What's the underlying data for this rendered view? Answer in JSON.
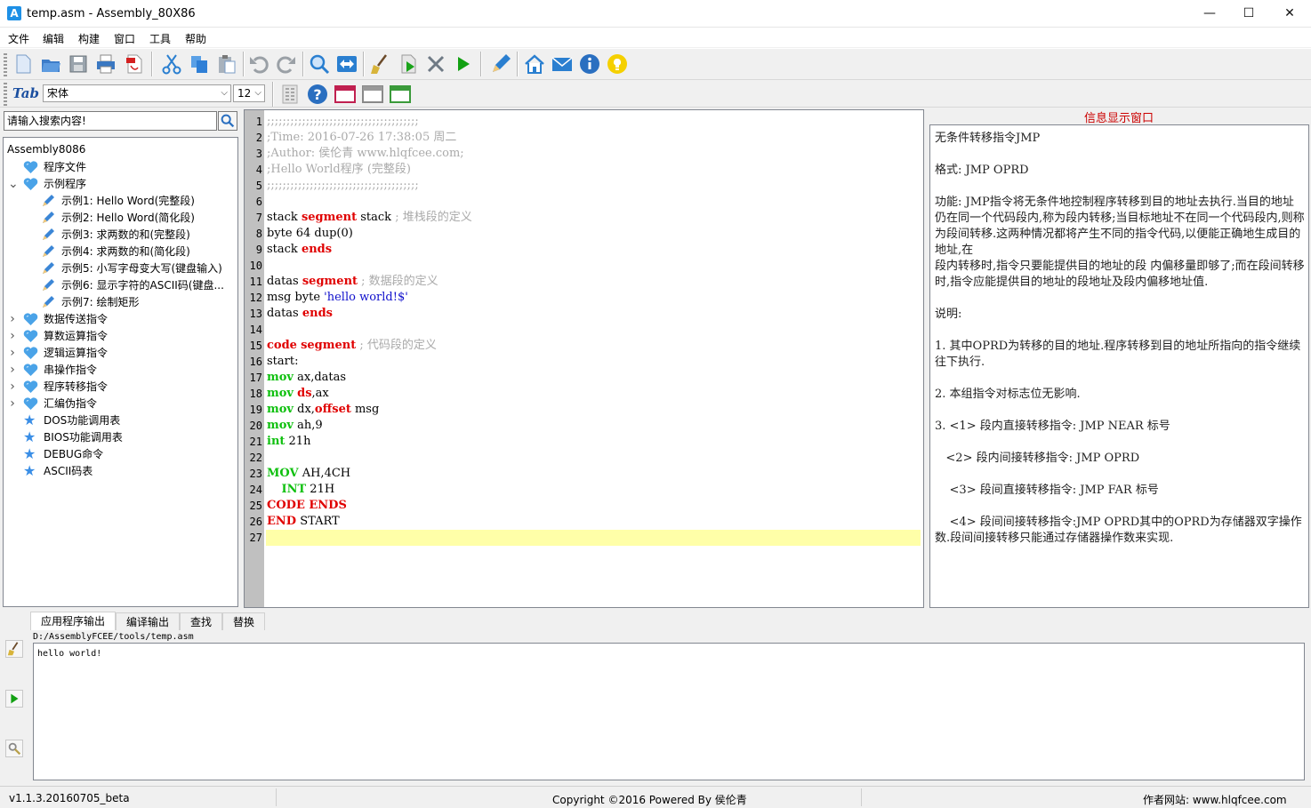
{
  "window": {
    "title": "temp.asm - Assembly_80X86",
    "app_icon_letter": "A",
    "minimize": "—",
    "maximize": "☐",
    "close": "✕"
  },
  "menu": [
    "文件",
    "编辑",
    "构建",
    "窗口",
    "工具",
    "帮助"
  ],
  "toolbar2": {
    "tab_label": "Tab",
    "font_name": "宋体",
    "font_size": "12"
  },
  "search": {
    "value": "请输入搜索内容!"
  },
  "tree": {
    "root": "Assembly8086",
    "items": [
      {
        "label": "程序文件",
        "icon": "heart-icon",
        "level": 1,
        "twisty": ""
      },
      {
        "label": "示例程序",
        "icon": "heart-icon",
        "level": 1,
        "twisty": "v"
      },
      {
        "label": "示例1:  Hello Word(完整段)",
        "icon": "pencil-icon",
        "level": 2,
        "twisty": ""
      },
      {
        "label": "示例2:  Hello Word(简化段)",
        "icon": "pencil-icon",
        "level": 2,
        "twisty": ""
      },
      {
        "label": "示例3:  求两数的和(完整段)",
        "icon": "pencil-icon",
        "level": 2,
        "twisty": ""
      },
      {
        "label": "示例4:  求两数的和(简化段)",
        "icon": "pencil-icon",
        "level": 2,
        "twisty": ""
      },
      {
        "label": "示例5:  小写字母变大写(键盘输入)",
        "icon": "pencil-icon",
        "level": 2,
        "twisty": ""
      },
      {
        "label": "示例6:  显示字符的ASCII码(键盘...",
        "icon": "pencil-icon",
        "level": 2,
        "twisty": ""
      },
      {
        "label": "示例7:  绘制矩形",
        "icon": "pencil-icon",
        "level": 2,
        "twisty": ""
      },
      {
        "label": "数据传送指令",
        "icon": "heart-icon",
        "level": 1,
        "twisty": ">"
      },
      {
        "label": "算数运算指令",
        "icon": "heart-icon",
        "level": 1,
        "twisty": ">"
      },
      {
        "label": "逻辑运算指令",
        "icon": "heart-icon",
        "level": 1,
        "twisty": ">"
      },
      {
        "label": "串操作指令",
        "icon": "heart-icon",
        "level": 1,
        "twisty": ">"
      },
      {
        "label": "程序转移指令",
        "icon": "heart-icon",
        "level": 1,
        "twisty": ">"
      },
      {
        "label": "汇编伪指令",
        "icon": "heart-icon",
        "level": 1,
        "twisty": ">"
      },
      {
        "label": "DOS功能调用表",
        "icon": "star-icon",
        "level": 1,
        "twisty": ""
      },
      {
        "label": "BIOS功能调用表",
        "icon": "star-icon",
        "level": 1,
        "twisty": ""
      },
      {
        "label": "DEBUG命令",
        "icon": "star-icon",
        "level": 1,
        "twisty": ""
      },
      {
        "label": "ASCII码表",
        "icon": "star-icon",
        "level": 1,
        "twisty": ""
      }
    ]
  },
  "editor": {
    "current_line": 27,
    "lines": [
      [
        [
          "cmt",
          ";;;;;;;;;;;;;;;;;;;;;;;;;;;;;;;;;;;;;;;"
        ]
      ],
      [
        [
          "cmt",
          ";Time: 2016-07-26 17:38:05 周二"
        ]
      ],
      [
        [
          "cmt",
          ";Author: 侯伦青 www.hlqfcee.com;"
        ]
      ],
      [
        [
          "cmt",
          ";Hello World程序 (完整段)"
        ]
      ],
      [
        [
          "cmt",
          ";;;;;;;;;;;;;;;;;;;;;;;;;;;;;;;;;;;;;;;"
        ]
      ],
      [],
      [
        [
          "",
          "stack "
        ],
        [
          "kw",
          "segment"
        ],
        [
          "",
          " stack "
        ],
        [
          "cmt",
          "; 堆栈段的定义"
        ]
      ],
      [
        [
          "",
          "byte 64 dup(0)"
        ]
      ],
      [
        [
          "",
          "stack "
        ],
        [
          "kw",
          "ends"
        ]
      ],
      [],
      [
        [
          "",
          "datas "
        ],
        [
          "kw",
          "segment"
        ],
        [
          "cmt",
          " ; 数据段的定义"
        ]
      ],
      [
        [
          "",
          "msg byte "
        ],
        [
          "str",
          "'hello world!$'"
        ]
      ],
      [
        [
          "",
          "datas "
        ],
        [
          "kw",
          "ends"
        ]
      ],
      [],
      [
        [
          "kw",
          "code"
        ],
        [
          "",
          " "
        ],
        [
          "kw",
          "segment"
        ],
        [
          "cmt",
          " ; 代码段的定义"
        ]
      ],
      [
        [
          "",
          "start:"
        ]
      ],
      [
        [
          "kw-g",
          "mov"
        ],
        [
          "",
          " ax,datas"
        ]
      ],
      [
        [
          "kw-g",
          "mov"
        ],
        [
          "",
          " "
        ],
        [
          "kw",
          "ds"
        ],
        [
          "",
          ",ax"
        ]
      ],
      [
        [
          "kw-g",
          "mov"
        ],
        [
          "",
          " dx,"
        ],
        [
          "kw",
          "offset"
        ],
        [
          "",
          " msg"
        ]
      ],
      [
        [
          "kw-g",
          "mov"
        ],
        [
          "",
          " ah,9"
        ]
      ],
      [
        [
          "kw-g",
          "int"
        ],
        [
          "",
          " 21h"
        ]
      ],
      [],
      [
        [
          "kw-g",
          "MOV"
        ],
        [
          "",
          " AH,4CH"
        ]
      ],
      [
        [
          "",
          "    "
        ],
        [
          "kw-g",
          "INT"
        ],
        [
          "",
          " 21H"
        ]
      ],
      [
        [
          "kw",
          "CODE ENDS"
        ]
      ],
      [
        [
          "kw",
          "END"
        ],
        [
          "",
          " START"
        ]
      ],
      []
    ]
  },
  "info": {
    "title": "信息显示窗口",
    "paragraphs": [
      "无条件转移指令JMP",
      "格式: JMP OPRD",
      "功能: JMP指令将无条件地控制程序转移到目的地址去执行.当目的地址仍在同一个代码段内,称为段内转移;当目标地址不在同一个代码段内,则称为段间转移.这两种情况都将产生不同的指令代码,以便能正确地生成目的地址,在\n段内转移时,指令只要能提供目的地址的段 内偏移量即够了;而在段间转移时,指令应能提供目的地址的段地址及段内偏移地址值.",
      "说明:",
      "1. 其中OPRD为转移的目的地址.程序转移到目的地址所指向的指令继续往下执行.",
      "2. 本组指令对标志位无影响.",
      "3. <1> 段内直接转移指令: JMP NEAR 标号",
      "   <2> 段内间接转移指令: JMP OPRD",
      "    <3> 段间直接转移指令: JMP FAR 标号",
      "    <4> 段间间接转移指令:JMP OPRD其中的OPRD为存储器双字操作数.段间间接转移只能通过存储器操作数来实现."
    ]
  },
  "bottom": {
    "tabs": [
      "应用程序输出",
      "编译输出",
      "查找",
      "替换"
    ],
    "path": "D:/AssemblyFCEE/tools/temp.asm",
    "output": "hello world!"
  },
  "status": {
    "version": "v1.1.3.20160705_beta",
    "copyright": "Copyright ©2016 Powered By 侯伦青",
    "site": "作者网站: www.hlqfcee.com"
  }
}
